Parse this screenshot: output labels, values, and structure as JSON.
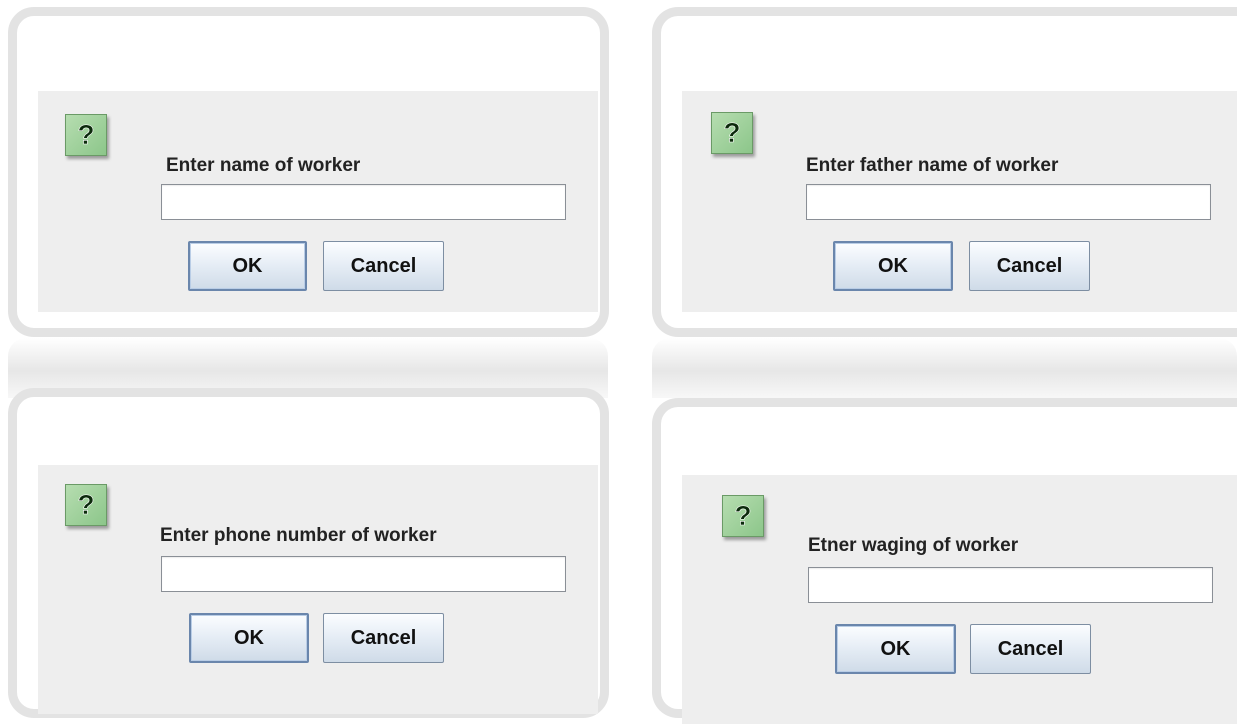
{
  "icon": {
    "name": "question-icon",
    "glyph": "?",
    "color": "#8cc68a"
  },
  "dialogs": [
    {
      "label": "Enter name of worker",
      "value": "",
      "ok": "OK",
      "cancel": "Cancel"
    },
    {
      "label": "Enter father name of worker",
      "value": "",
      "ok": "OK",
      "cancel": "Cancel"
    },
    {
      "label": "Enter phone number of worker",
      "value": "",
      "ok": "OK",
      "cancel": "Cancel"
    },
    {
      "label": "Etner waging of worker",
      "value": "",
      "ok": "OK",
      "cancel": "Cancel"
    }
  ]
}
